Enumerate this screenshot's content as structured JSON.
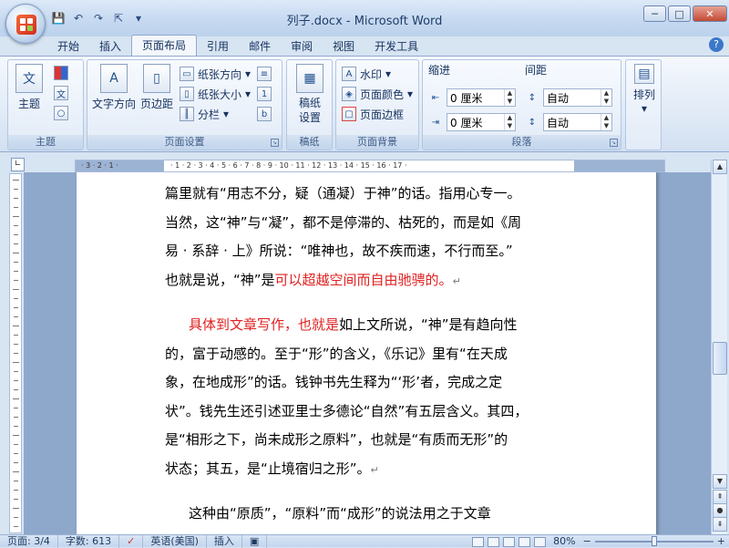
{
  "window": {
    "title": "列子.docx - Microsoft Word",
    "minimize_icon": "minimize-icon",
    "maximize_icon": "maximize-icon",
    "close_icon": "close-icon"
  },
  "quick_access": [
    "save-icon",
    "undo-icon",
    "redo-icon",
    "select-icon",
    "customize-icon"
  ],
  "tabs": [
    "开始",
    "插入",
    "页面布局",
    "引用",
    "邮件",
    "审阅",
    "视图",
    "开发工具"
  ],
  "active_tab": "页面布局",
  "ribbon": {
    "theme_group": {
      "label": "主题",
      "theme_button": "主题"
    },
    "page_setup": {
      "label": "页面设置",
      "text_direction": "文字方向",
      "margins": "页边距",
      "orientation": "纸张方向",
      "size": "纸张大小",
      "columns": "分栏"
    },
    "manuscript": {
      "label": "稿纸",
      "button": "稿纸\n设置"
    },
    "page_background": {
      "label": "页面背景",
      "watermark": "水印",
      "page_color": "页面颜色",
      "page_borders": "页面边框"
    },
    "paragraph": {
      "label": "段落",
      "indent_label": "缩进",
      "spacing_label": "间距",
      "indent_left": "0 厘米",
      "indent_right": "0 厘米",
      "spacing_before": "自动",
      "spacing_after": "自动"
    },
    "arrange": {
      "label": "排列"
    }
  },
  "ruler": {
    "ticks": "3 · 2 · 1 · 1 · 2 · 3 · 4 · 5 · 6 · 7 · 8 · 9 · 10 · 11 · 12 · 13 · 14 · 15 · 16 · 17 ·",
    "left_ticks": "· 3 · 2 · 1 ·",
    "main_ticks": "· 1 · 2 · 3 · 4 · 5 · 6 · 7 · 8 · 9 · 10 · 11 · 12 · 13 · 14 · 15 · 16 · 17 ·"
  },
  "document": {
    "p1": [
      {
        "text": "篇里就有“用志不分，疑（通凝）于神”的话。指用心专一。",
        "color": "#000000"
      },
      {
        "text": "当然，这“神”与“凝”，都不是停滞的、枯死的，而是如《周",
        "color": "#000000"
      },
      {
        "text": "易 · 系辞 · 上》所说：“唯神也，故不疾而速，不行而至。”",
        "color": "#000000"
      }
    ],
    "p1_last_black": "也就是说，“神”是",
    "p1_last_red": "可以超越空间而自由驰骋的。",
    "p2_red": "具体到文章写作，也就是",
    "p2_rest": "如上文所说，“神”是有趋向性",
    "p2_lines": [
      "的，富于动感的。至于“形”的含义，《乐记》里有“在天成",
      "象，在地成形”的话。钱钟书先生释为“‘形’者，完成之定",
      "状”。钱先生还引述亚里士多德论“自然”有五层含义。其四，",
      "是“相形之下，尚未成形之原料”，也就是“有质而无形”的",
      "状态；其五，是“止境宿归之形”。"
    ],
    "p3": "这种由“原质”，“原料”而“成形”的说法用之于文章",
    "paragraph_mark": "↵",
    "red_color": "#e02020"
  },
  "status": {
    "page": "页面: 3/4",
    "words": "字数: 613",
    "language": "英语(美国)",
    "mode": "插入",
    "zoom": "80%",
    "zoom_minus": "−",
    "zoom_plus": "+"
  }
}
